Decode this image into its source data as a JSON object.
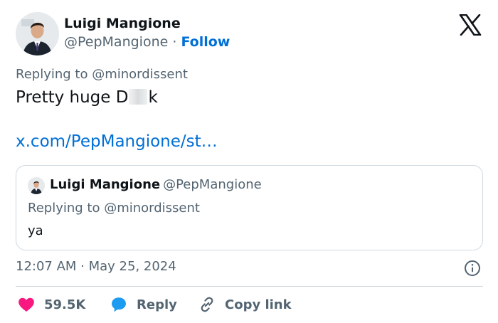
{
  "colors": {
    "accent": "#006fd6",
    "secondary_text": "#536471",
    "primary_text": "#0f1419",
    "like": "#f91880",
    "border": "#cfd9de"
  },
  "author": {
    "name": "Luigi Mangione",
    "handle": "@PepMangione",
    "separator": " · ",
    "follow_label": "Follow"
  },
  "tweet": {
    "replying_to": "Replying to @minordissent",
    "text_before": "Pretty huge D",
    "text_after": "k",
    "link": "x.com/PepMangione/st…"
  },
  "quoted": {
    "name": "Luigi Mangione",
    "handle": "@PepMangione",
    "replying_to": "Replying to @minordissent",
    "text": "ya"
  },
  "meta": {
    "timestamp": "12:07 AM · May 25, 2024"
  },
  "actions": {
    "like_count": "59.5K",
    "reply_label": "Reply",
    "copy_link_label": "Copy link"
  },
  "icons": {
    "logo": "x-logo-icon",
    "info": "info-icon",
    "like": "heart-icon",
    "reply": "speech-bubble-icon",
    "copy": "link-icon"
  }
}
